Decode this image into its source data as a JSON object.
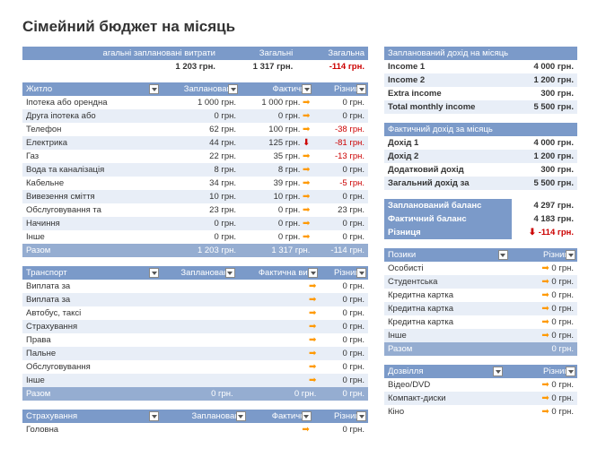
{
  "title": "Сімейний бюджет на місяць",
  "currency": "грн.",
  "top_summary": {
    "headers": [
      "агальні заплановані витрати",
      "Загальні",
      "Загальна"
    ],
    "values": [
      "1 203 грн.",
      "1 317 грн.",
      "-114 грн."
    ]
  },
  "housing": {
    "headers": [
      "Житло",
      "Запланована",
      "Фактична",
      "Різниця"
    ],
    "rows": [
      {
        "label": "Іпотека або орендна",
        "plan": "1 000 грн.",
        "fact": "1 000 грн.",
        "diff": "0 грн.",
        "ind": "r"
      },
      {
        "label": "Друга іпотека або",
        "plan": "0 грн.",
        "fact": "0 грн.",
        "diff": "0 грн.",
        "ind": "r"
      },
      {
        "label": "Телефон",
        "plan": "62 грн.",
        "fact": "100 грн.",
        "diff": "-38 грн.",
        "ind": "r",
        "neg": true
      },
      {
        "label": "Електрика",
        "plan": "44 грн.",
        "fact": "125 грн.",
        "diff": "-81 грн.",
        "ind": "d",
        "neg": true
      },
      {
        "label": "Газ",
        "plan": "22 грн.",
        "fact": "35 грн.",
        "diff": "-13 грн.",
        "ind": "r",
        "neg": true
      },
      {
        "label": "Вода та каналізація",
        "plan": "8 грн.",
        "fact": "8 грн.",
        "diff": "0 грн.",
        "ind": "r"
      },
      {
        "label": "Кабельне",
        "plan": "34 грн.",
        "fact": "39 грн.",
        "diff": "-5 грн.",
        "ind": "r",
        "neg": true
      },
      {
        "label": "Вивезення сміття",
        "plan": "10 грн.",
        "fact": "10 грн.",
        "diff": "0 грн.",
        "ind": "r"
      },
      {
        "label": "Обслуговування та",
        "plan": "23 грн.",
        "fact": "0 грн.",
        "diff": "23 грн.",
        "ind": "r"
      },
      {
        "label": "Начиння",
        "plan": "0 грн.",
        "fact": "0 грн.",
        "diff": "0 грн.",
        "ind": "r"
      },
      {
        "label": "Інше",
        "plan": "0 грн.",
        "fact": "0 грн.",
        "diff": "0 грн.",
        "ind": "r"
      }
    ],
    "total": {
      "label": "Разом",
      "plan": "1 203 грн.",
      "fact": "1 317 грн.",
      "diff": "-114 грн.",
      "neg": true
    }
  },
  "transport": {
    "headers": [
      "Транспорт",
      "Запланована",
      "Фактична витр",
      "Різниця"
    ],
    "rows": [
      {
        "label": "Виплата за",
        "plan": "",
        "fact": "",
        "diff": "0 грн.",
        "ind": "r"
      },
      {
        "label": "Виплата за",
        "plan": "",
        "fact": "",
        "diff": "0 грн.",
        "ind": "r"
      },
      {
        "label": "Автобус, таксі",
        "plan": "",
        "fact": "",
        "diff": "0 грн.",
        "ind": "r"
      },
      {
        "label": "Страхування",
        "plan": "",
        "fact": "",
        "diff": "0 грн.",
        "ind": "r"
      },
      {
        "label": "Права",
        "plan": "",
        "fact": "",
        "diff": "0 грн.",
        "ind": "r"
      },
      {
        "label": "Пальне",
        "plan": "",
        "fact": "",
        "diff": "0 грн.",
        "ind": "r"
      },
      {
        "label": "Обслуговування",
        "plan": "",
        "fact": "",
        "diff": "0 грн.",
        "ind": "r"
      },
      {
        "label": "Інше",
        "plan": "",
        "fact": "",
        "diff": "0 грн.",
        "ind": "r"
      }
    ],
    "total": {
      "label": "Разом",
      "plan": "0 грн.",
      "fact": "0 грн.",
      "diff": "0 грн."
    }
  },
  "insurance": {
    "headers": [
      "Страхування",
      "Запланована",
      "Фактична",
      "Різниця"
    ],
    "rows": [
      {
        "label": "Головна",
        "plan": "",
        "fact": "",
        "diff": "0 грн.",
        "ind": "r"
      }
    ]
  },
  "planned_income": {
    "header": "Запланований дохід на місяць",
    "rows": [
      {
        "label": "Income 1",
        "val": "4 000 грн."
      },
      {
        "label": "Income 2",
        "val": "1 200 грн."
      },
      {
        "label": "Extra income",
        "val": "300 грн."
      },
      {
        "label": "Total monthly income",
        "val": "5 500 грн."
      }
    ]
  },
  "actual_income": {
    "header": "Фактичний дохід за місяць",
    "rows": [
      {
        "label": "Дохід 1",
        "val": "4 000 грн."
      },
      {
        "label": "Дохід 2",
        "val": "1 200 грн."
      },
      {
        "label": "Додатковий дохід",
        "val": "300 грн."
      },
      {
        "label": "Загальний дохід за",
        "val": "5 500 грн."
      }
    ]
  },
  "balance": {
    "rows": [
      {
        "label": "Запланований баланс",
        "val": "4 297 грн.",
        "hdr": true
      },
      {
        "label": "Фактичний баланс",
        "val": "4 183 грн.",
        "hdr": true
      },
      {
        "label": "Різниця",
        "val": "-114 грн.",
        "ind": "d",
        "neg": true,
        "hdr": true
      }
    ]
  },
  "loans": {
    "headers": [
      "Позики",
      "Різниця"
    ],
    "rows": [
      {
        "label": "Особисті",
        "diff": "0 грн.",
        "ind": "r"
      },
      {
        "label": "Студентська",
        "diff": "0 грн.",
        "ind": "r"
      },
      {
        "label": "Кредитна картка",
        "diff": "0 грн.",
        "ind": "r"
      },
      {
        "label": "Кредитна картка",
        "diff": "0 грн.",
        "ind": "r"
      },
      {
        "label": "Кредитна картка",
        "diff": "0 грн.",
        "ind": "r"
      },
      {
        "label": "Інше",
        "diff": "0 грн.",
        "ind": "r"
      }
    ],
    "total": {
      "label": "Разом",
      "diff": "0 грн."
    }
  },
  "leisure": {
    "headers": [
      "Дозвілля",
      "Різниця"
    ],
    "rows": [
      {
        "label": "Відео/DVD",
        "diff": "0 грн.",
        "ind": "r"
      },
      {
        "label": "Компакт-диски",
        "diff": "0 грн.",
        "ind": "r"
      },
      {
        "label": "Кіно",
        "diff": "0 грн.",
        "ind": "r"
      }
    ]
  }
}
